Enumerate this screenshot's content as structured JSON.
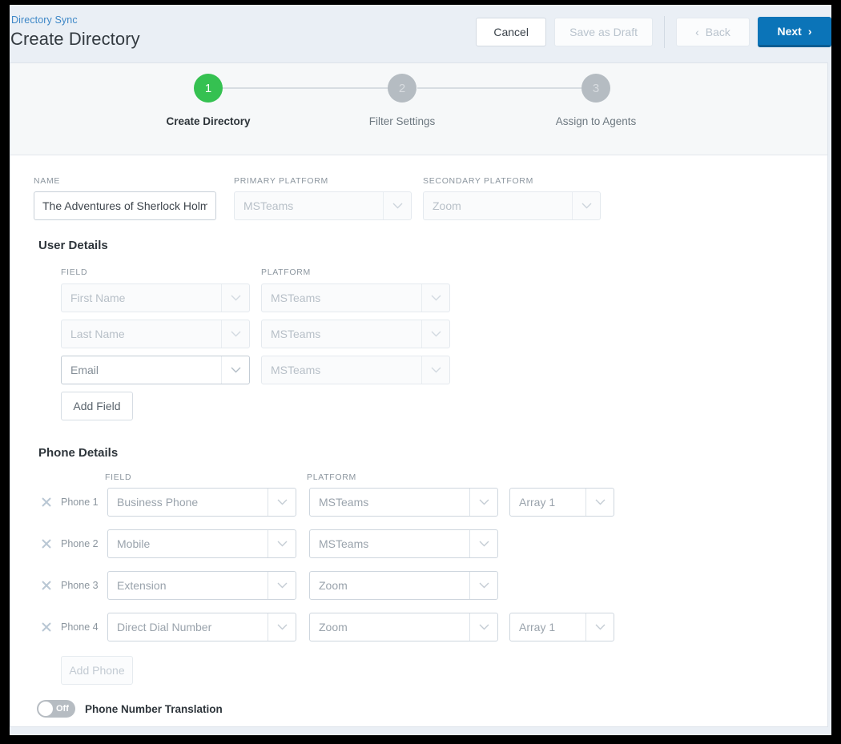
{
  "header": {
    "breadcrumb": "Directory Sync",
    "title": "Create Directory",
    "buttons": {
      "cancel": "Cancel",
      "save_draft": "Save as Draft",
      "back": "Back",
      "next": "Next"
    },
    "icons": {
      "back_chevron": "‹",
      "next_chevron": "›"
    }
  },
  "stepper": {
    "steps": [
      {
        "number": "1",
        "label": "Create Directory",
        "state": "active"
      },
      {
        "number": "2",
        "label": "Filter Settings",
        "state": "inactive"
      },
      {
        "number": "3",
        "label": "Assign to Agents",
        "state": "inactive"
      }
    ]
  },
  "top_fields": {
    "name": {
      "label": "NAME",
      "value": "The Adventures of Sherlock Holmes",
      "placeholder": ""
    },
    "primary_platform": {
      "label": "PRIMARY PLATFORM",
      "value": "MSTeams"
    },
    "secondary_platform": {
      "label": "SECONDARY PLATFORM",
      "value": "Zoom"
    }
  },
  "user_details": {
    "title": "User Details",
    "col_field": "FIELD",
    "col_platform": "PLATFORM",
    "rows": [
      {
        "field": "First Name",
        "platform": "MSTeams",
        "enabled": false
      },
      {
        "field": "Last Name",
        "platform": "MSTeams",
        "enabled": false
      },
      {
        "field": "Email",
        "platform": "MSTeams",
        "enabled": true
      }
    ],
    "add_button": "Add Field"
  },
  "phone_details": {
    "title": "Phone Details",
    "col_field": "FIELD",
    "col_platform": "PLATFORM",
    "rows": [
      {
        "name": "Phone 1",
        "field": "Business Phone",
        "platform": "MSTeams",
        "array": "Array 1"
      },
      {
        "name": "Phone 2",
        "field": "Mobile",
        "platform": "MSTeams",
        "array": null
      },
      {
        "name": "Phone 3",
        "field": "Extension",
        "platform": "Zoom",
        "array": null
      },
      {
        "name": "Phone 4",
        "field": "Direct Dial Number",
        "platform": "Zoom",
        "array": "Array 1"
      }
    ],
    "add_button": "Add Phone",
    "add_button_disabled": true
  },
  "translation_toggle": {
    "state_text": "Off",
    "label": "Phone Number Translation",
    "on": false
  },
  "colors": {
    "accent_blue": "#0b74b8",
    "step_active_green": "#35c151",
    "step_inactive_gray": "#b5bcc2",
    "breadcrumb_link": "#3d87c7",
    "page_bg": "#eaeff5",
    "toggle_off": "#b6bcc2"
  }
}
